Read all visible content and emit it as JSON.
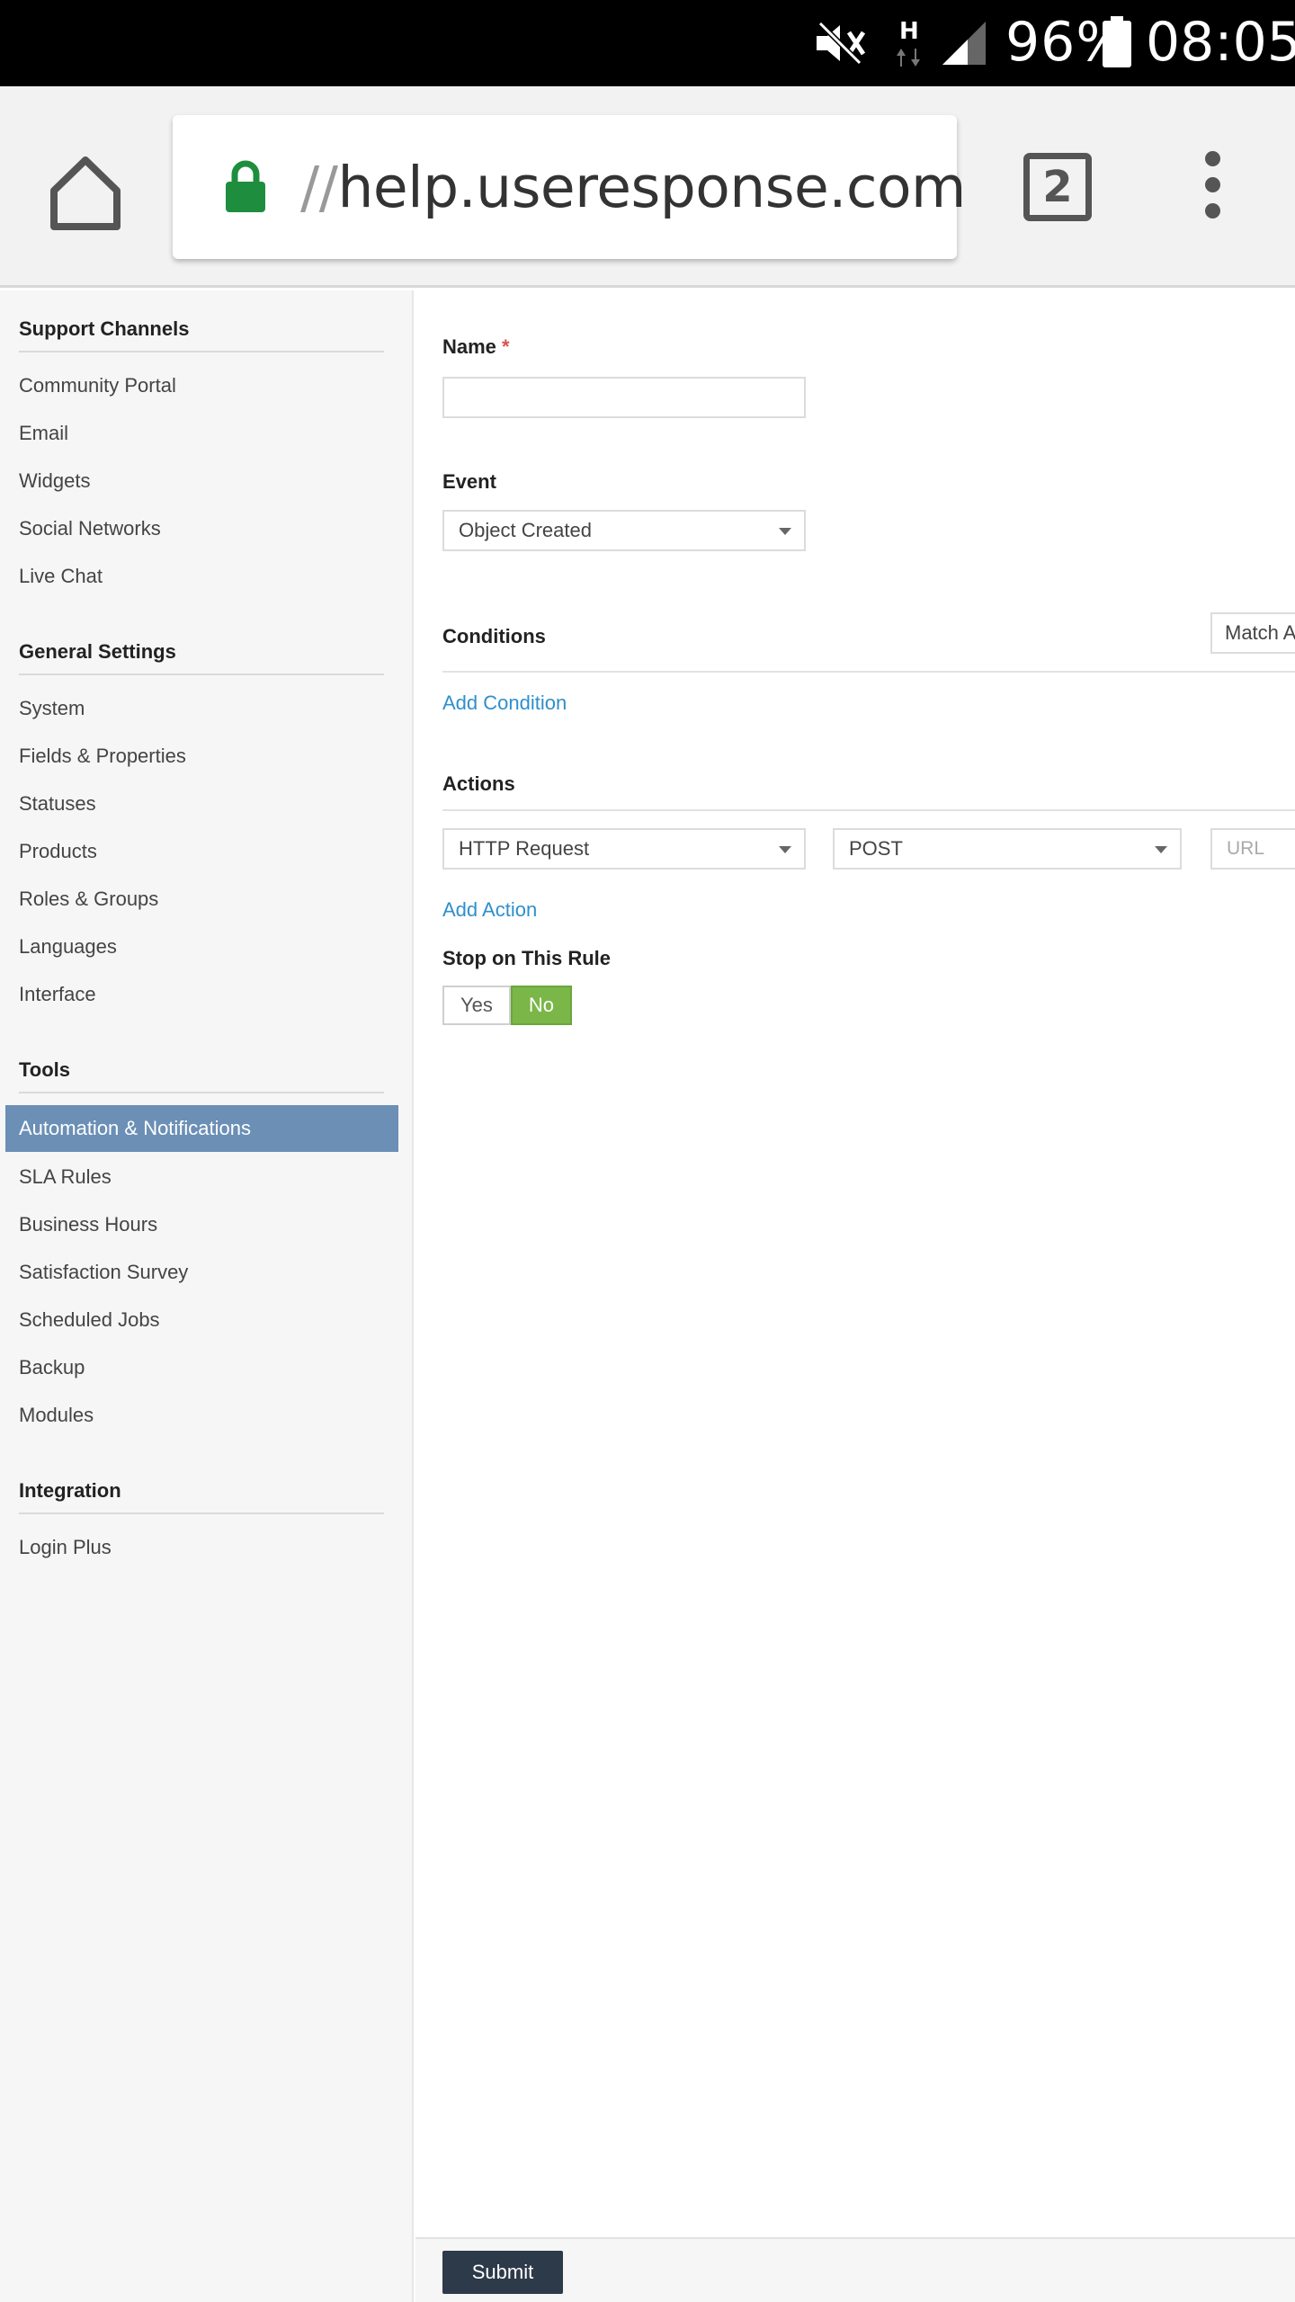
{
  "status_bar": {
    "battery_percent": "96%",
    "time": "08:05",
    "network_type": "H",
    "icons": [
      "mute-icon",
      "network-h-icon",
      "signal-icon",
      "battery-icon"
    ]
  },
  "browser": {
    "url_scheme": "//",
    "url_host": "help.useresponse.com",
    "tab_count": "2",
    "icons": [
      "home-icon",
      "lock-icon",
      "tabs-icon",
      "overflow-menu-icon"
    ],
    "lock_color": "#1e8e3e"
  },
  "sidebar": {
    "sections": [
      {
        "title": "Support Channels",
        "items": [
          "Community Portal",
          "Email",
          "Widgets",
          "Social Networks",
          "Live Chat"
        ]
      },
      {
        "title": "General Settings",
        "items": [
          "System",
          "Fields & Properties",
          "Statuses",
          "Products",
          "Roles & Groups",
          "Languages",
          "Interface"
        ]
      },
      {
        "title": "Tools",
        "items": [
          "Automation & Notifications",
          "SLA Rules",
          "Business Hours",
          "Satisfaction Survey",
          "Scheduled Jobs",
          "Backup",
          "Modules"
        ]
      },
      {
        "title": "Integration",
        "items": [
          "Login Plus"
        ]
      }
    ],
    "active_item": "Automation & Notifications",
    "active_color": "#6b8fb5"
  },
  "form": {
    "name_label": "Name",
    "required_mark": "*",
    "name_value": "",
    "event_label": "Event",
    "event_value": "Object Created",
    "conditions_label": "Conditions",
    "match_value": "Match A",
    "add_condition": "Add Condition",
    "actions_label": "Actions",
    "action_type_value": "HTTP Request",
    "method_value": "POST",
    "url_placeholder": "URL",
    "add_action": "Add Action",
    "stop_label": "Stop on This Rule",
    "stop_yes": "Yes",
    "stop_no": "No",
    "stop_selected": "No",
    "submit_label": "Submit",
    "accent_green": "#7ab648",
    "link_color": "#2f8fcc"
  }
}
